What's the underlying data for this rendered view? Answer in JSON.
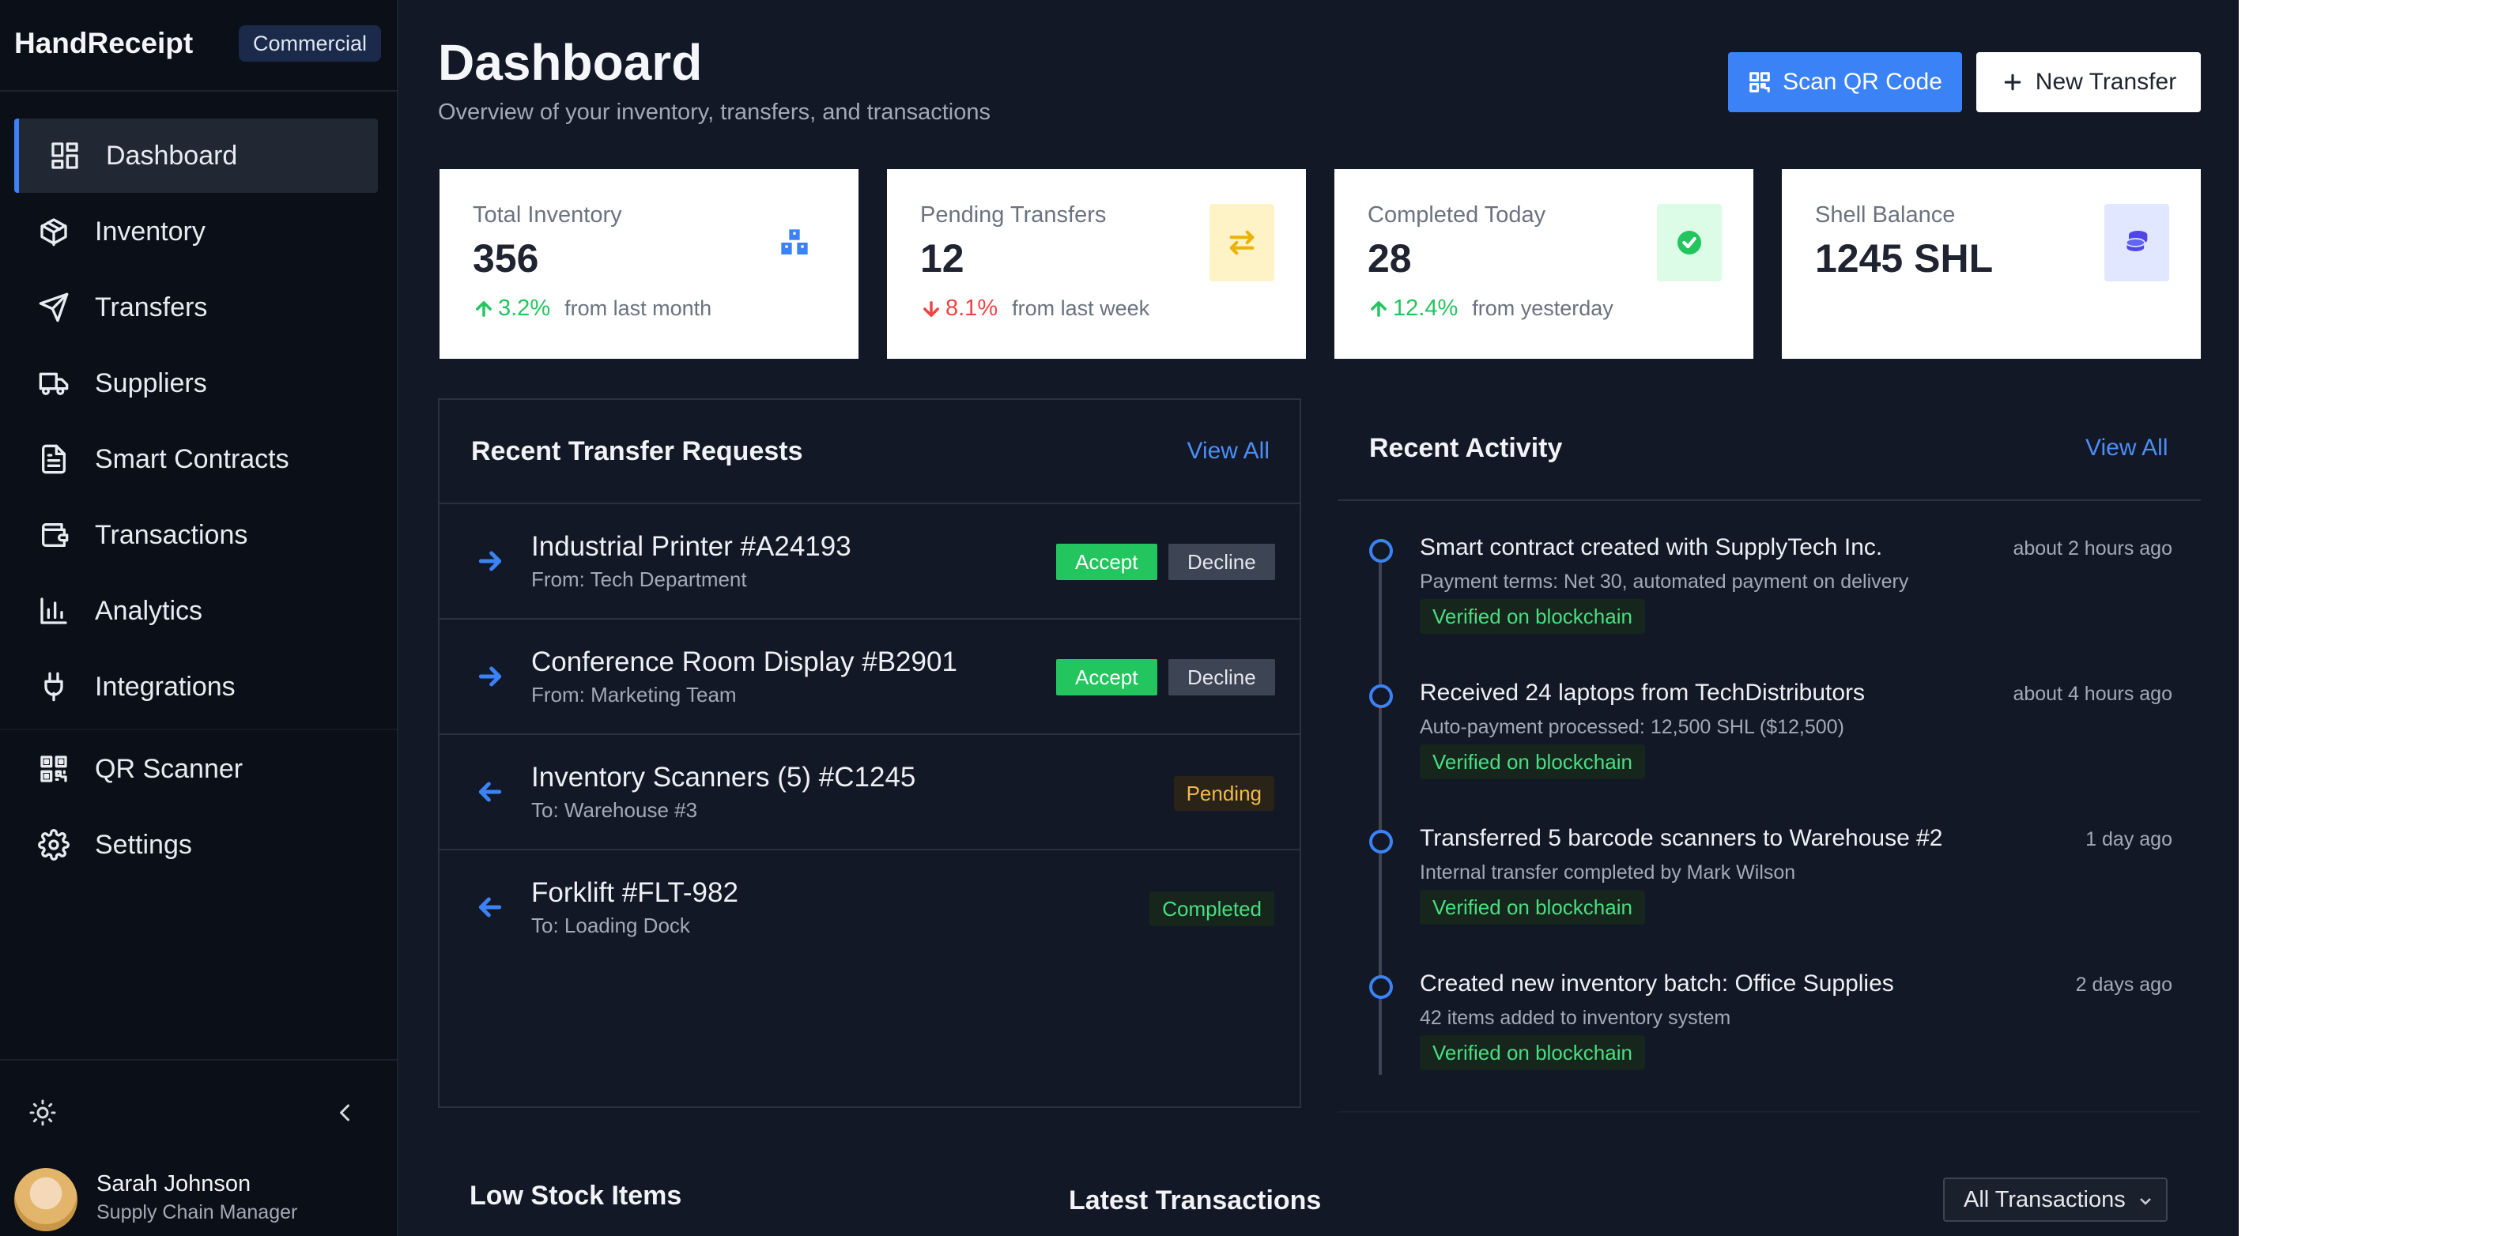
{
  "app": {
    "brand": "HandReceipt",
    "brand_badge": "Commercial"
  },
  "sidebar": {
    "items": [
      {
        "label": "Dashboard",
        "icon": "grid-icon",
        "active": true
      },
      {
        "label": "Inventory",
        "icon": "box-icon"
      },
      {
        "label": "Transfers",
        "icon": "send-icon"
      },
      {
        "label": "Suppliers",
        "icon": "truck-icon"
      },
      {
        "label": "Smart Contracts",
        "icon": "file-text-icon"
      },
      {
        "label": "Transactions",
        "icon": "wallet-icon"
      },
      {
        "label": "Analytics",
        "icon": "bar-chart-icon"
      },
      {
        "label": "Integrations",
        "icon": "plug-icon"
      },
      {
        "label": "QR Scanner",
        "icon": "qr-code-icon"
      },
      {
        "label": "Settings",
        "icon": "gear-icon"
      }
    ],
    "user": {
      "name": "Sarah Johnson",
      "role": "Supply Chain Manager"
    }
  },
  "header": {
    "title": "Dashboard",
    "subtitle": "Overview of your inventory, transfers, and transactions",
    "scan_label": "Scan QR Code",
    "new_transfer_label": "New Transfer"
  },
  "stats": [
    {
      "label": "Total Inventory",
      "value": "356",
      "delta": "3.2%",
      "direction": "up",
      "context": "from last month",
      "icon": "boxes-icon",
      "icon_bg": "#ffffff",
      "icon_color": "#3b82f6"
    },
    {
      "label": "Pending Transfers",
      "value": "12",
      "delta": "8.1%",
      "direction": "down",
      "context": "from last week",
      "icon": "arrows-exchange-icon",
      "icon_bg": "#fef3c7",
      "icon_color": "#eab308"
    },
    {
      "label": "Completed Today",
      "value": "28",
      "delta": "12.4%",
      "direction": "up",
      "context": "from yesterday",
      "icon": "check-circle-icon",
      "icon_bg": "#dcfce7",
      "icon_color": "#22c55e"
    },
    {
      "label": "Shell Balance",
      "value": "1245 SHL",
      "icon": "coins-icon",
      "icon_bg": "#e0e7ff",
      "icon_color": "#4f46e5"
    }
  ],
  "transfers": {
    "title": "Recent Transfer Requests",
    "view_all": "View All",
    "rows": [
      {
        "name": "Industrial Printer #A24193",
        "sub": "From: Tech Department",
        "direction": "incoming",
        "accept": "Accept",
        "decline": "Decline"
      },
      {
        "name": "Conference Room Display #B2901",
        "sub": "From: Marketing Team",
        "direction": "incoming",
        "accept": "Accept",
        "decline": "Decline"
      },
      {
        "name": "Inventory Scanners (5) #C1245",
        "sub": "To: Warehouse #3",
        "direction": "outgoing",
        "status": "Pending"
      },
      {
        "name": "Forklift #FLT-982",
        "sub": "To: Loading Dock",
        "direction": "outgoing",
        "status": "Completed"
      }
    ]
  },
  "activity": {
    "title": "Recent Activity",
    "view_all": "View All",
    "items": [
      {
        "title": "Smart contract created with SupplyTech Inc.",
        "desc": "Payment terms: Net 30, automated payment on delivery",
        "time": "about 2 hours ago",
        "badge": "Verified on blockchain"
      },
      {
        "title": "Received 24 laptops from TechDistributors",
        "desc": "Auto-payment processed: 12,500 SHL ($12,500)",
        "time": "about 4 hours ago",
        "badge": "Verified on blockchain"
      },
      {
        "title": "Transferred 5 barcode scanners to Warehouse #2",
        "desc": "Internal transfer completed by Mark Wilson",
        "time": "1 day ago",
        "badge": "Verified on blockchain"
      },
      {
        "title": "Created new inventory batch: Office Supplies",
        "desc": "42 items added to inventory system",
        "time": "2 days ago",
        "badge": "Verified on blockchain"
      }
    ]
  },
  "low_stock": {
    "title": "Low Stock Items"
  },
  "latest_transactions": {
    "title": "Latest Transactions",
    "filter": "All Transactions"
  }
}
